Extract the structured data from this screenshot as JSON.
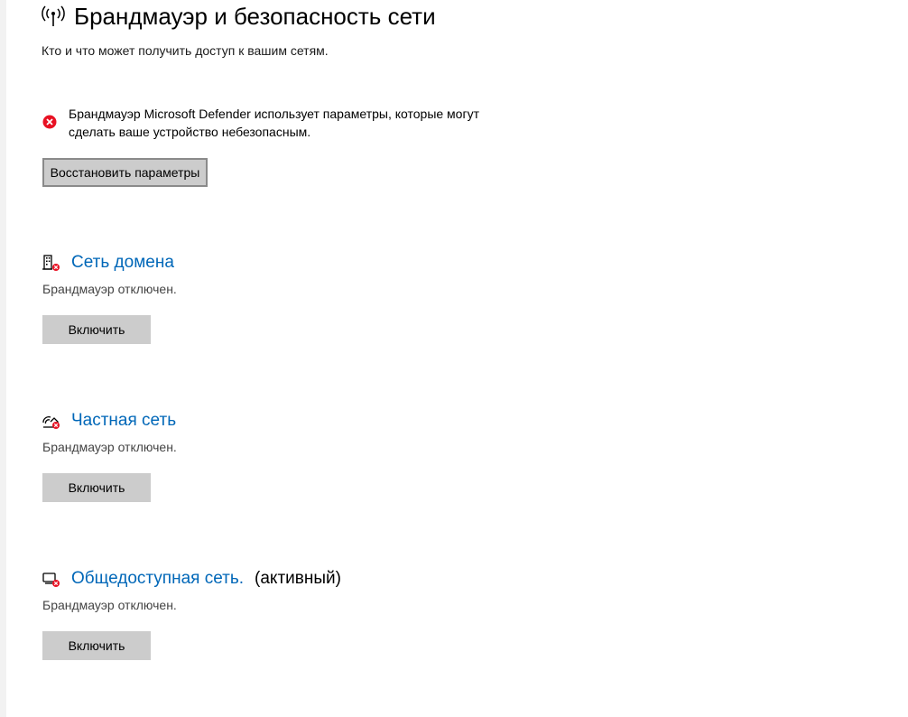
{
  "header": {
    "icon": "wifi-signal-icon",
    "title": "Брандмауэр и безопасность сети",
    "subtitle": "Кто и что может получить доступ к вашим сетям."
  },
  "warning": {
    "icon": "error-circle-icon",
    "color": "#e81123",
    "text": "Брандмауэр Microsoft Defender использует параметры, которые могут сделать ваше устройство небезопасным.",
    "restore_label": "Восстановить параметры"
  },
  "networks": [
    {
      "icon": "domain-building-icon",
      "name": "Сеть домена",
      "active_label": "",
      "status": "Брандмауэр отключен.",
      "button_label": "Включить"
    },
    {
      "icon": "private-network-icon",
      "name": "Частная сеть",
      "active_label": "",
      "status": "Брандмауэр отключен.",
      "button_label": "Включить"
    },
    {
      "icon": "public-network-icon",
      "name": "Общедоступная сеть.",
      "active_label": "(активный)",
      "status": "Брандмауэр отключен.",
      "button_label": "Включить"
    }
  ],
  "colors": {
    "link": "#0067b8",
    "button": "#cccccc",
    "error": "#e81123"
  }
}
